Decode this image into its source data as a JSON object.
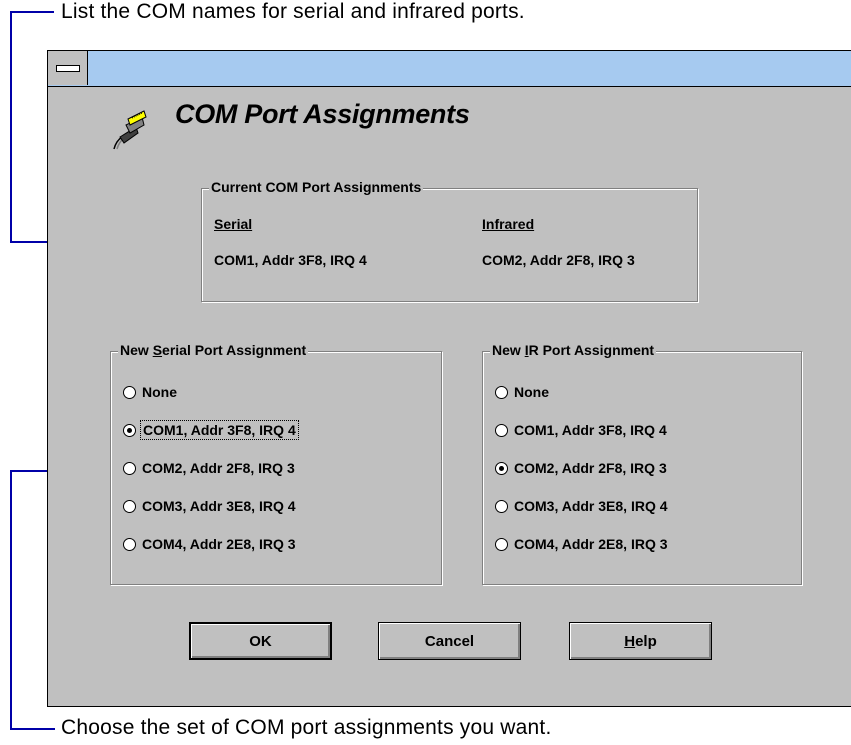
{
  "callouts": {
    "top": "List the COM names for serial and infrared ports.",
    "bottom": "Choose the set of COM port assignments you want."
  },
  "colors": {
    "bracket": "#0000a8",
    "titlebar": "#a6caf0",
    "dialog": "#c0c0c0"
  },
  "dialog": {
    "title": "COM Port Assignments",
    "icon": "serial-plug-icon",
    "current": {
      "legend": "Current COM Port Assignments",
      "serial_header": "Serial",
      "infrared_header": "Infrared",
      "serial_value": "COM1, Addr 3F8, IRQ 4",
      "infrared_value": "COM2, Addr 2F8, IRQ 3"
    },
    "serial_group": {
      "legend_pre": "New ",
      "legend_mnemonic": "S",
      "legend_post": "erial Port Assignment",
      "options": [
        "None",
        "COM1, Addr 3F8, IRQ 4",
        "COM2, Addr 2F8, IRQ 3",
        "COM3, Addr 3E8, IRQ 4",
        "COM4, Addr 2E8, IRQ 3"
      ],
      "selected": "COM1, Addr 3F8, IRQ 4"
    },
    "ir_group": {
      "legend_pre": "New ",
      "legend_mnemonic": "I",
      "legend_post": "R Port Assignment",
      "options": [
        "None",
        "COM1, Addr 3F8, IRQ 4",
        "COM2, Addr 2F8, IRQ 3",
        "COM3, Addr 3E8, IRQ 4",
        "COM4, Addr 2E8, IRQ 3"
      ],
      "selected": "COM2, Addr 2F8, IRQ 3"
    },
    "buttons": {
      "ok": "OK",
      "cancel": "Cancel",
      "help_mnemonic": "H",
      "help_rest": "elp"
    }
  }
}
